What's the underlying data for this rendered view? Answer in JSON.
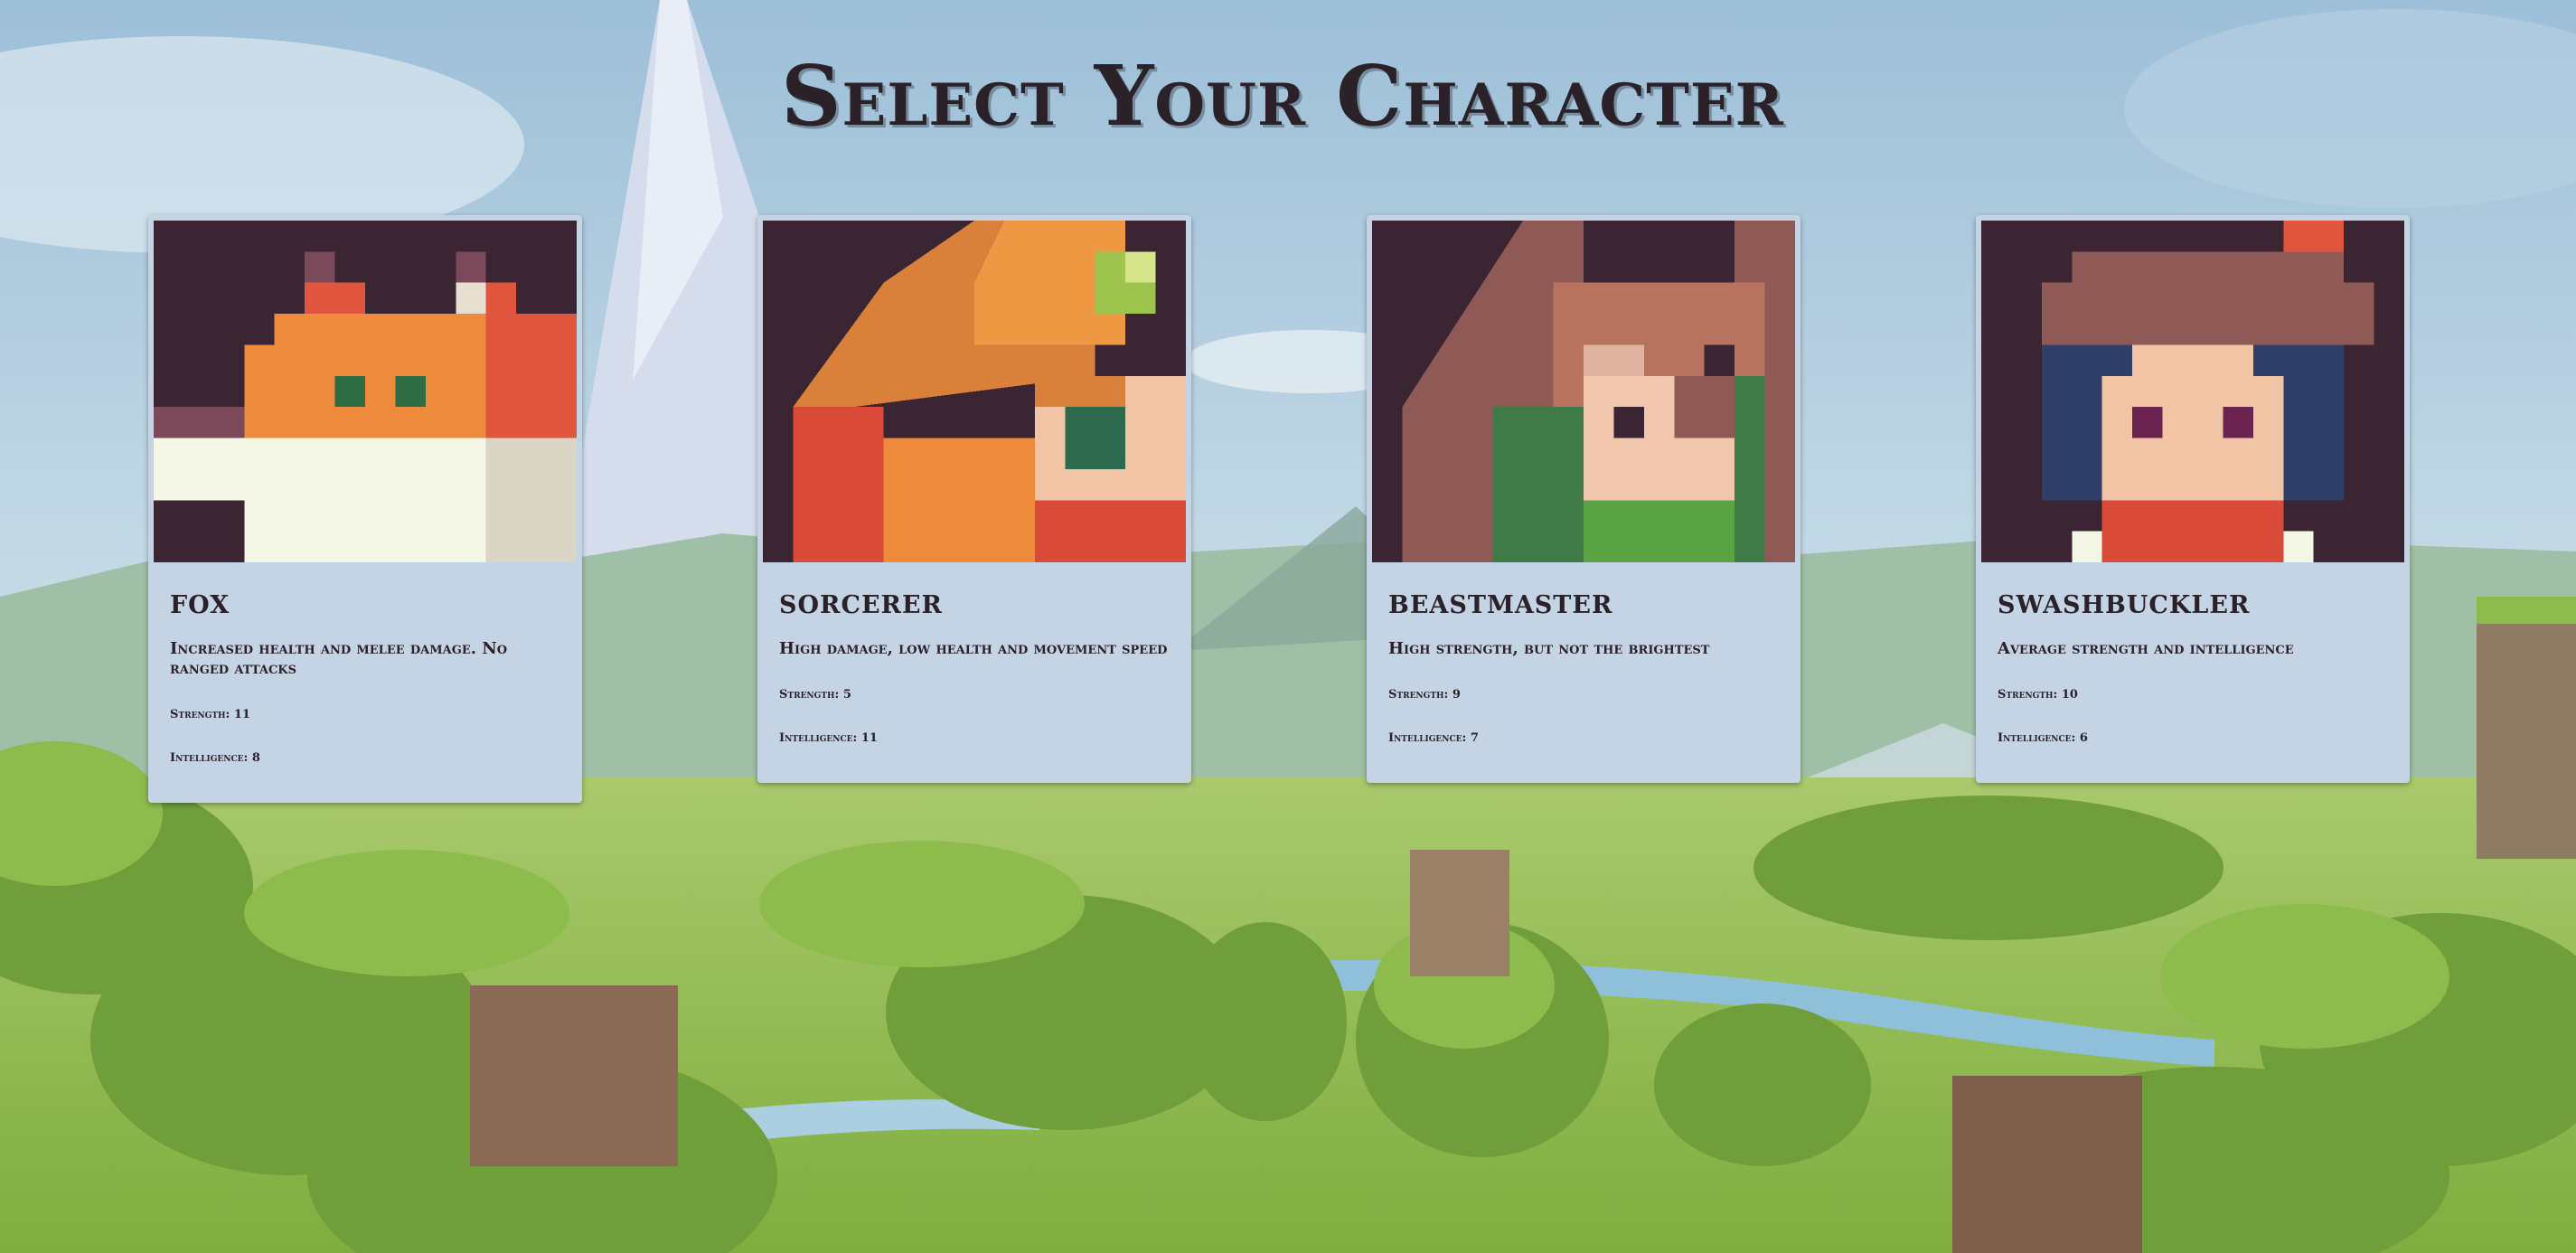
{
  "page": {
    "title": "Select Your Character"
  },
  "characters": [
    {
      "name": "FOX",
      "description": "Increased health and melee damage. No ranged attacks",
      "strength": "Strength: 11",
      "intelligence": "Intelligence: 8"
    },
    {
      "name": "SORCERER",
      "description": "High damage, low health and movement speed",
      "strength": "Strength: 5",
      "intelligence": "Intelligence: 11"
    },
    {
      "name": "BEASTMASTER",
      "description": "High strength, but not the brightest",
      "strength": "Strength: 9",
      "intelligence": "Intelligence: 7"
    },
    {
      "name": "SWASHBUCKLER",
      "description": "Average strength and intelligence",
      "strength": "Strength: 10",
      "intelligence": "Intelligence: 6"
    }
  ],
  "colors": {
    "card_bg": "#c5d4e5",
    "title_text": "#2b2129",
    "sky": "#a9c7de",
    "grass": "#8fbf4e"
  }
}
